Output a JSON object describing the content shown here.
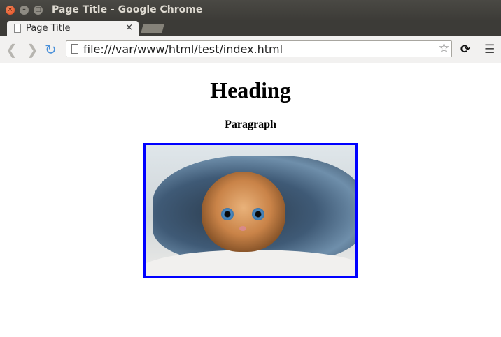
{
  "window": {
    "title": "Page Title - Google Chrome"
  },
  "tabs": [
    {
      "label": "Page Title",
      "close": "×",
      "active": true
    }
  ],
  "toolbar": {
    "url": "file:///var/www/html/test/index.html"
  },
  "page": {
    "heading": "Heading",
    "paragraph": "Paragraph",
    "image_border_color": "#0000ff"
  },
  "icons": {
    "back": "back-arrow-icon",
    "forward": "forward-arrow-icon",
    "reload": "reload-icon",
    "bookmark": "star-icon",
    "extension": "extension-icon",
    "menu": "hamburger-menu-icon"
  }
}
